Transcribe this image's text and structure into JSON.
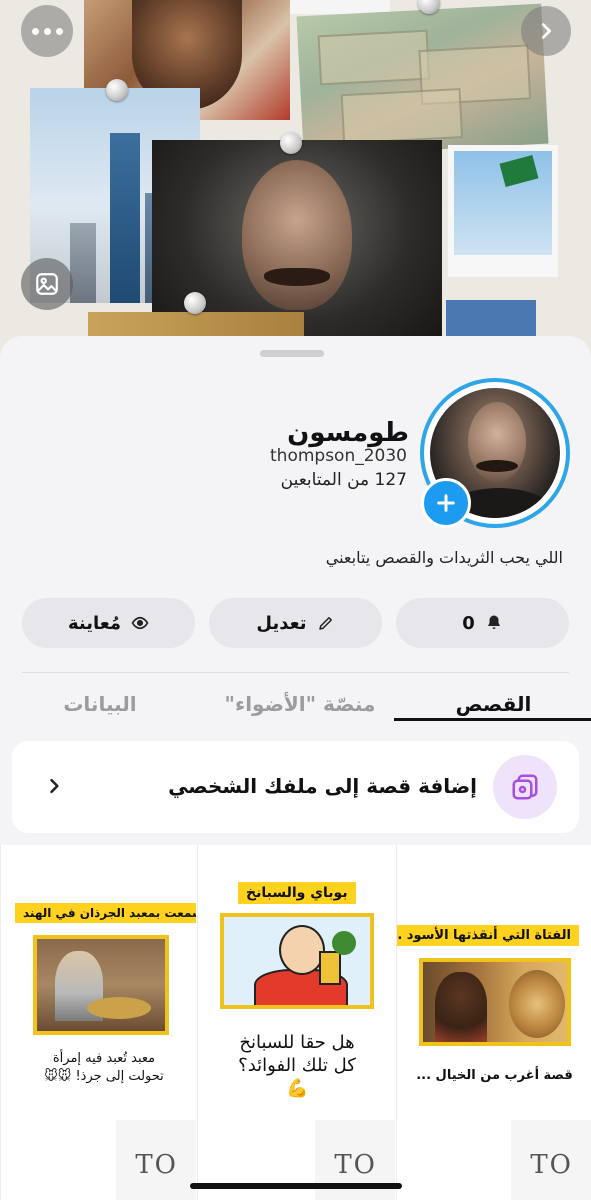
{
  "hero": {
    "more_icon": "more-horizontal-icon",
    "next_icon": "chevron-right-icon",
    "image_icon": "image-icon"
  },
  "profile": {
    "display_name": "طومسون",
    "username": "thompson_2030",
    "followers": "127 من المتابعين",
    "bio": "اللي يحب الثريدات والقصص يتابعني",
    "ring_color": "#2ea5e8",
    "add_button_color": "#1d9bf0"
  },
  "actions": {
    "notify_count": "0",
    "notify_icon": "bell-icon",
    "edit_label": "تعديل",
    "edit_icon": "pencil-icon",
    "preview_label": "مُعاينة",
    "preview_icon": "eye-icon"
  },
  "tabs": [
    {
      "label": "القصص",
      "active": true
    },
    {
      "label": "منصّة \"الأضواء\"",
      "active": false
    },
    {
      "label": "البيانات",
      "active": false
    }
  ],
  "add_story": {
    "label": "إضافة قصة إلى ملفك الشخصي",
    "icon": "add-story-icon",
    "icon_bg": "#efe3fb"
  },
  "stories": [
    {
      "tag": "الفتاة التي أنقذتها الأسود ...",
      "caption": "قصة أغرب من الخيال ...",
      "watermark": "TO"
    },
    {
      "tag": "بوباي والسبانخ",
      "caption_line1": "هل حقا للسبانخ",
      "caption_line2": "كل تلك الفوائد؟",
      "emoji": "💪",
      "watermark": "TO"
    },
    {
      "tag": "هل سمعت بمعبد الجرذان في الهند",
      "caption_line1": "معبد تُعبد فيه إمرأة",
      "caption_line2": "تحولت إلى جرذ! 🐭🐭",
      "watermark": "TO"
    }
  ],
  "colors": {
    "tag_yellow": "#ffd21f",
    "photo_border": "#f2c21c",
    "sheet_bg": "#f4f4f6"
  }
}
